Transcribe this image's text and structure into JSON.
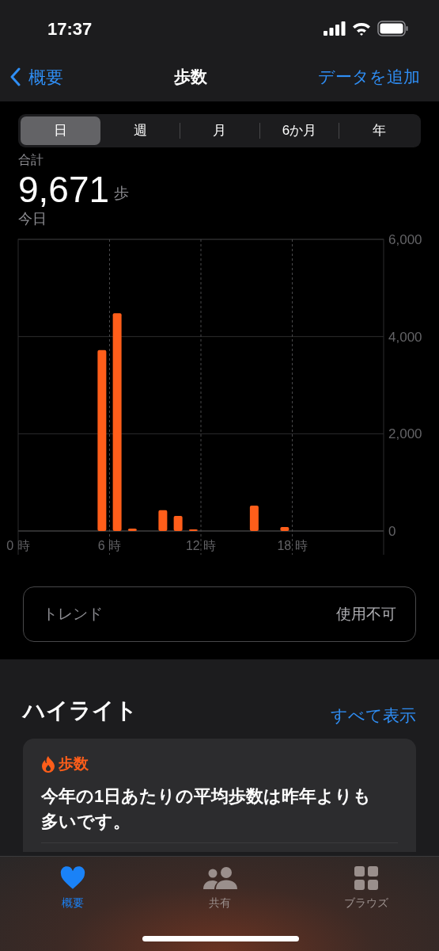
{
  "status_bar": {
    "time": "17:37"
  },
  "nav": {
    "back": "概要",
    "title": "歩数",
    "action": "データを追加"
  },
  "segments": [
    {
      "label": "日",
      "selected": true
    },
    {
      "label": "週",
      "selected": false
    },
    {
      "label": "月",
      "selected": false
    },
    {
      "label": "6か月",
      "selected": false
    },
    {
      "label": "年",
      "selected": false
    }
  ],
  "summary": {
    "label": "合計",
    "value": "9,671",
    "unit": "歩",
    "period": "今日"
  },
  "chart_data": {
    "type": "bar",
    "grid": true,
    "x": [
      5.5,
      6.5,
      7.5,
      9.5,
      10.5,
      11.5,
      15.5,
      17.5
    ],
    "series": [
      {
        "color": "#ff5e1a",
        "values": [
          3720,
          4480,
          50,
          430,
          310,
          30,
          520,
          80
        ]
      }
    ],
    "xlim": [
      0,
      24
    ],
    "ylim": [
      0,
      6000
    ],
    "xticks": [
      {
        "value": 0,
        "label": "0 時"
      },
      {
        "value": 6,
        "label": "6 時"
      },
      {
        "value": 12,
        "label": "12 時"
      },
      {
        "value": 18,
        "label": "18 時"
      }
    ],
    "yticks": [
      {
        "value": 0,
        "label": "0"
      },
      {
        "value": 2000,
        "label": "2,000"
      },
      {
        "value": 4000,
        "label": "4,000"
      },
      {
        "value": 6000,
        "label": "6,000"
      }
    ]
  },
  "trend": {
    "label": "トレンド",
    "value": "使用不可"
  },
  "highlights": {
    "title": "ハイライト",
    "link": "すべて表示",
    "card": {
      "category": "歩数",
      "text": "今年の1日あたりの平均歩数は昨年よりも多いです。"
    }
  },
  "tab_bar": [
    {
      "kind": "heart",
      "label": "概要",
      "selected": true
    },
    {
      "kind": "people",
      "label": "共有",
      "selected": false
    },
    {
      "kind": "grid",
      "label": "ブラウズ",
      "selected": false
    }
  ]
}
